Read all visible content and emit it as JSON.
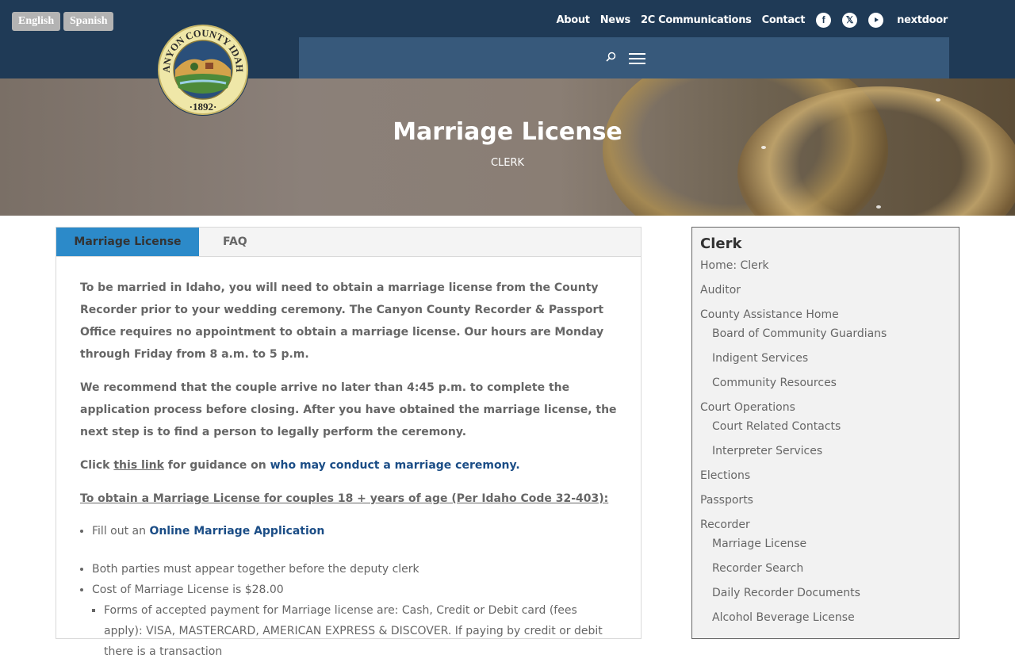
{
  "language": {
    "english": "English",
    "spanish": "Spanish"
  },
  "topnav": {
    "about": "About",
    "news": "News",
    "communications": "2C Communications",
    "contact": "Contact",
    "nextdoor": "nextdoor"
  },
  "social_icons": [
    "facebook-icon",
    "x-icon",
    "youtube-icon"
  ],
  "seal": {
    "top_text": "CANYON COUNTY IDAHO",
    "year": "·1892·"
  },
  "hero": {
    "title": "Marriage License",
    "subtitle": "CLERK"
  },
  "tabs": [
    {
      "label": "Marriage License",
      "active": true
    },
    {
      "label": "FAQ",
      "active": false
    }
  ],
  "content": {
    "p1": "To be married in Idaho, you will need to obtain a marriage license from the County Recorder prior to your wedding ceremony. The Canyon County Recorder & Passport Office requires no appointment to obtain a marriage license. Our hours are Monday through Friday from 8 a.m. to 5 p.m.",
    "p2": "We recommend that the couple arrive no later than 4:45 p.m. to complete the application process before closing. After you have obtained the marriage license, the next step is to find a person to legally perform the ceremony.",
    "p3_before": "Click ",
    "p3_link": "this link",
    "p3_middle": " for guidance on ",
    "p3_link2": "who may conduct a marriage ceremony.",
    "heading": "To obtain a Marriage License for couples 18 + years of age (Per Idaho Code 32-403):",
    "bullet1_before": "Fill out an ",
    "bullet1_link": "Online Marriage Application",
    "bullet2": "Both parties must appear together before the deputy clerk",
    "bullet3": "Cost of Marriage License is $28.00",
    "sub_bullet": "Forms of accepted payment for Marriage license are: Cash, Credit or Debit card (fees apply): VISA, MASTERCARD, AMERICAN EXPRESS & DISCOVER. If paying by credit or debit there is a transaction"
  },
  "sidebar": {
    "title": "Clerk",
    "items": [
      {
        "label": "Home: Clerk",
        "level": 0
      },
      {
        "label": "Auditor",
        "level": 0
      },
      {
        "label": "County Assistance Home",
        "level": 0
      },
      {
        "label": "Board of Community Guardians",
        "level": 1
      },
      {
        "label": "Indigent Services",
        "level": 1
      },
      {
        "label": "Community Resources",
        "level": 1
      },
      {
        "label": "Court Operations",
        "level": 0
      },
      {
        "label": "Court Related Contacts",
        "level": 1
      },
      {
        "label": "Interpreter Services",
        "level": 1
      },
      {
        "label": "Elections",
        "level": 0
      },
      {
        "label": "Passports",
        "level": 0
      },
      {
        "label": "Recorder",
        "level": 0
      },
      {
        "label": "Marriage License",
        "level": 1
      },
      {
        "label": "Recorder Search",
        "level": 1
      },
      {
        "label": "Daily Recorder Documents",
        "level": 1
      },
      {
        "label": "Alcohol Beverage License",
        "level": 1
      }
    ]
  }
}
